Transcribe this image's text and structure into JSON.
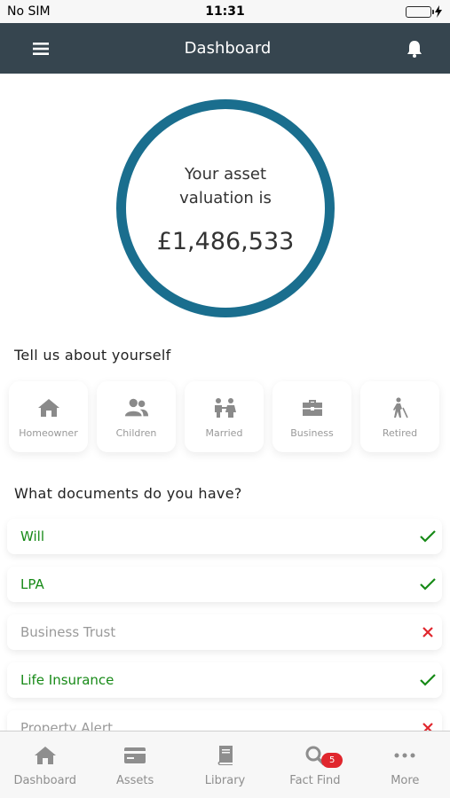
{
  "status_bar": {
    "carrier": "No SIM",
    "time": "11:31",
    "battery_percent": 100
  },
  "header": {
    "title": "Dashboard",
    "menu_icon": "hamburger-icon",
    "bell_icon": "bell-icon"
  },
  "valuation": {
    "label": "Your asset valuation is",
    "amount": "£1,486,533",
    "ring_color": "#1a6e8e"
  },
  "situation": {
    "title": "Tell us about yourself",
    "items": [
      {
        "label": "Homeowner",
        "icon": "home-icon"
      },
      {
        "label": "Children",
        "icon": "users-icon"
      },
      {
        "label": "Married",
        "icon": "couple-icon"
      },
      {
        "label": "Business",
        "icon": "briefcase-icon"
      },
      {
        "label": "Retired",
        "icon": "walking-cane-icon"
      }
    ]
  },
  "documents": {
    "title": "What documents do you have?",
    "items": [
      {
        "name": "Will",
        "status": "have"
      },
      {
        "name": "LPA",
        "status": "have"
      },
      {
        "name": "Business Trust",
        "status": "missing"
      },
      {
        "name": "Life Insurance",
        "status": "have"
      },
      {
        "name": "Property Alert",
        "status": "missing"
      }
    ],
    "colors": {
      "have": "#178a17",
      "missing": "#e0262d"
    }
  },
  "tabs": {
    "items": [
      {
        "label": "Dashboard",
        "icon": "home-icon"
      },
      {
        "label": "Assets",
        "icon": "card-icon"
      },
      {
        "label": "Library",
        "icon": "book-icon"
      },
      {
        "label": "Fact Find",
        "icon": "search-icon",
        "badge": "5"
      },
      {
        "label": "More",
        "icon": "more-icon"
      }
    ]
  }
}
